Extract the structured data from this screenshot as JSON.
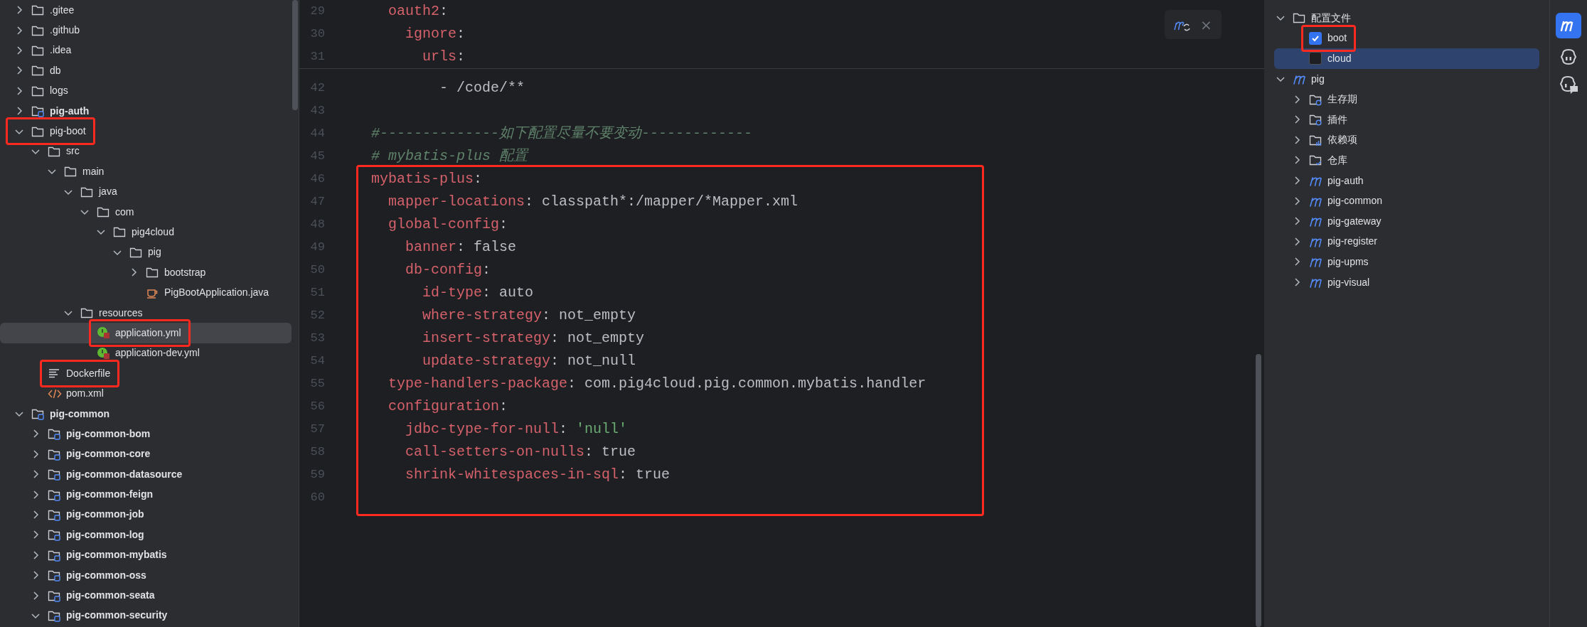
{
  "project_tree": [
    {
      "name": ".gitee",
      "kind": "folder",
      "expanded": false,
      "selected": false
    },
    {
      "name": ".github",
      "kind": "folder",
      "expanded": false,
      "selected": false
    },
    {
      "name": ".idea",
      "kind": "folder",
      "expanded": false,
      "selected": false
    },
    {
      "name": "db",
      "kind": "folder",
      "expanded": false,
      "selected": false
    },
    {
      "name": "logs",
      "kind": "folder",
      "expanded": false,
      "selected": false
    },
    {
      "name": "pig-auth",
      "kind": "module",
      "expanded": false,
      "selected": false
    },
    {
      "name": "pig-boot",
      "kind": "folder",
      "expanded": true,
      "selected": false,
      "highlighted": true,
      "children": [
        {
          "name": "src",
          "kind": "folder",
          "expanded": true,
          "selected": false,
          "children": [
            {
              "name": "main",
              "kind": "folder",
              "expanded": true,
              "selected": false,
              "children": [
                {
                  "name": "java",
                  "kind": "folder",
                  "expanded": true,
                  "selected": false,
                  "children": [
                    {
                      "name": "com",
                      "kind": "folder",
                      "expanded": true,
                      "selected": false,
                      "children": [
                        {
                          "name": "pig4cloud",
                          "kind": "folder",
                          "expanded": true,
                          "selected": false,
                          "children": [
                            {
                              "name": "pig",
                              "kind": "folder",
                              "expanded": true,
                              "selected": false,
                              "children": [
                                {
                                  "name": "bootstrap",
                                  "kind": "folder",
                                  "expanded": false,
                                  "selected": false
                                },
                                {
                                  "name": "PigBootApplication.java",
                                  "kind": "java",
                                  "selected": false
                                }
                              ]
                            }
                          ]
                        }
                      ]
                    }
                  ]
                },
                {
                  "name": "resources",
                  "kind": "folder",
                  "expanded": true,
                  "selected": false,
                  "children": [
                    {
                      "name": "application.yml",
                      "kind": "yml",
                      "selected": true,
                      "highlighted": true
                    },
                    {
                      "name": "application-dev.yml",
                      "kind": "yml",
                      "selected": false
                    }
                  ]
                }
              ]
            }
          ]
        },
        {
          "name": "Dockerfile",
          "kind": "text",
          "selected": false,
          "highlighted": true
        },
        {
          "name": "pom.xml",
          "kind": "xml",
          "selected": false
        }
      ]
    },
    {
      "name": "pig-common",
      "kind": "module",
      "expanded": true,
      "selected": false,
      "children": [
        {
          "name": "pig-common-bom",
          "kind": "module",
          "expanded": false,
          "selected": false
        },
        {
          "name": "pig-common-core",
          "kind": "module",
          "expanded": false,
          "selected": false
        },
        {
          "name": "pig-common-datasource",
          "kind": "module",
          "expanded": false,
          "selected": false
        },
        {
          "name": "pig-common-feign",
          "kind": "module",
          "expanded": false,
          "selected": false
        },
        {
          "name": "pig-common-job",
          "kind": "module",
          "expanded": false,
          "selected": false
        },
        {
          "name": "pig-common-log",
          "kind": "module",
          "expanded": false,
          "selected": false
        },
        {
          "name": "pig-common-mybatis",
          "kind": "module",
          "expanded": false,
          "selected": false
        },
        {
          "name": "pig-common-oss",
          "kind": "module",
          "expanded": false,
          "selected": false
        },
        {
          "name": "pig-common-seata",
          "kind": "module",
          "expanded": false,
          "selected": false
        },
        {
          "name": "pig-common-security",
          "kind": "module",
          "expanded": true,
          "selected": false
        }
      ]
    }
  ],
  "editor": {
    "sticky_lines": [
      {
        "number": "29",
        "parts": [
          {
            "kind": "key",
            "text": "  oauth2"
          },
          {
            "kind": "punct",
            "text": ":"
          }
        ]
      },
      {
        "number": "30",
        "parts": [
          {
            "kind": "key",
            "text": "    ignore"
          },
          {
            "kind": "punct",
            "text": ":"
          }
        ]
      },
      {
        "number": "31",
        "parts": [
          {
            "kind": "key",
            "text": "      urls"
          },
          {
            "kind": "punct",
            "text": ":"
          }
        ]
      }
    ],
    "sections": [
      {
        "lines": [
          {
            "number": "42",
            "parts": [
              {
                "kind": "value",
                "text": "        - /code/**"
              }
            ]
          },
          {
            "number": "43"
          },
          {
            "number": "44",
            "parts": [
              {
                "kind": "comment",
                "text": "#--------------如下配置尽量不要变动-------------"
              }
            ]
          },
          {
            "number": "45",
            "parts": [
              {
                "kind": "comment",
                "text": "# mybatis-plus 配置"
              }
            ]
          }
        ]
      },
      {
        "highlighted": true,
        "lines": [
          {
            "number": "46",
            "parts": [
              {
                "kind": "key",
                "text": "mybatis-plus"
              },
              {
                "kind": "punct",
                "text": ":"
              }
            ]
          },
          {
            "number": "47",
            "parts": [
              {
                "kind": "key",
                "text": "  mapper-locations"
              },
              {
                "kind": "punct",
                "text": ": "
              },
              {
                "kind": "value",
                "text": "classpath*:/mapper/*Mapper.xml"
              }
            ]
          },
          {
            "number": "48",
            "parts": [
              {
                "kind": "key",
                "text": "  global-config"
              },
              {
                "kind": "punct",
                "text": ":"
              }
            ]
          },
          {
            "number": "49",
            "parts": [
              {
                "kind": "key",
                "text": "    banner"
              },
              {
                "kind": "punct",
                "text": ": "
              },
              {
                "kind": "value",
                "text": "false"
              }
            ]
          },
          {
            "number": "50",
            "parts": [
              {
                "kind": "key",
                "text": "    db-config"
              },
              {
                "kind": "punct",
                "text": ":"
              }
            ]
          },
          {
            "number": "51",
            "parts": [
              {
                "kind": "key",
                "text": "      id-type"
              },
              {
                "kind": "punct",
                "text": ": "
              },
              {
                "kind": "value",
                "text": "auto"
              }
            ]
          },
          {
            "number": "52",
            "parts": [
              {
                "kind": "key",
                "text": "      where-strategy"
              },
              {
                "kind": "punct",
                "text": ": "
              },
              {
                "kind": "value",
                "text": "not_empty"
              }
            ]
          },
          {
            "number": "53",
            "parts": [
              {
                "kind": "key",
                "text": "      insert-strategy"
              },
              {
                "kind": "punct",
                "text": ": "
              },
              {
                "kind": "value",
                "text": "not_empty"
              }
            ]
          },
          {
            "number": "54",
            "parts": [
              {
                "kind": "key",
                "text": "      update-strategy"
              },
              {
                "kind": "punct",
                "text": ": "
              },
              {
                "kind": "value",
                "text": "not_null"
              }
            ]
          },
          {
            "number": "55",
            "parts": [
              {
                "kind": "key",
                "text": "  type-handlers-package"
              },
              {
                "kind": "punct",
                "text": ": "
              },
              {
                "kind": "value",
                "text": "com.pig4cloud.pig.common.mybatis.handler"
              }
            ]
          },
          {
            "number": "56",
            "parts": [
              {
                "kind": "key",
                "text": "  configuration"
              },
              {
                "kind": "punct",
                "text": ":"
              }
            ]
          },
          {
            "number": "57",
            "parts": [
              {
                "kind": "key",
                "text": "    jdbc-type-for-null"
              },
              {
                "kind": "punct",
                "text": ": "
              },
              {
                "kind": "string",
                "text": "'null'"
              }
            ]
          },
          {
            "number": "58",
            "parts": [
              {
                "kind": "key",
                "text": "    call-setters-on-nulls"
              },
              {
                "kind": "punct",
                "text": ": "
              },
              {
                "kind": "value",
                "text": "true"
              }
            ]
          },
          {
            "number": "59",
            "parts": [
              {
                "kind": "key",
                "text": "    shrink-whitespaces-in-sql"
              },
              {
                "kind": "punct",
                "text": ": "
              },
              {
                "kind": "value",
                "text": "true"
              }
            ]
          },
          {
            "number": "60"
          }
        ]
      }
    ],
    "float_toolbar": {
      "close": "×"
    }
  },
  "maven_tree": [
    {
      "name": "配置文件",
      "kind": "folder",
      "expanded": true,
      "selected": false,
      "children": [
        {
          "name": "boot",
          "kind": "profile",
          "checked": true,
          "selected": false,
          "highlighted": true
        },
        {
          "name": "cloud",
          "kind": "profile",
          "checked": false,
          "selected": true
        }
      ]
    },
    {
      "name": "pig",
      "kind": "maven",
      "expanded": true,
      "selected": false,
      "children": [
        {
          "name": "生存期",
          "kind": "lifecycle",
          "expanded": false,
          "selected": false
        },
        {
          "name": "插件",
          "kind": "plugins",
          "expanded": false,
          "selected": false
        },
        {
          "name": "依赖项",
          "kind": "dependencies",
          "expanded": false,
          "selected": false
        },
        {
          "name": "仓库",
          "kind": "repository",
          "expanded": false,
          "selected": false
        },
        {
          "name": "pig-auth",
          "kind": "maven",
          "expanded": false,
          "selected": false
        },
        {
          "name": "pig-common",
          "kind": "maven",
          "expanded": false,
          "selected": false
        },
        {
          "name": "pig-gateway",
          "kind": "maven",
          "expanded": false,
          "selected": false
        },
        {
          "name": "pig-register",
          "kind": "maven",
          "expanded": false,
          "selected": false
        },
        {
          "name": "pig-upms",
          "kind": "maven",
          "expanded": false,
          "selected": false
        },
        {
          "name": "pig-visual",
          "kind": "maven",
          "expanded": false,
          "selected": false
        }
      ]
    }
  ]
}
